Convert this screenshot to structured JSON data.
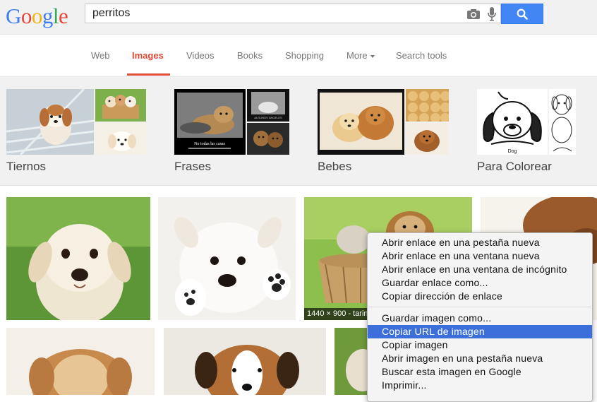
{
  "logo": {
    "letters": [
      "G",
      "o",
      "o",
      "g",
      "l",
      "e"
    ],
    "colors": [
      "#3f7ef0",
      "#e8443a",
      "#f2b50f",
      "#3f7ef0",
      "#31a852",
      "#e8443a"
    ]
  },
  "search": {
    "query": "perritos",
    "placeholder": ""
  },
  "icons": {
    "camera": "camera-icon",
    "mic": "mic-icon",
    "search": "magnifier-icon"
  },
  "tabs": [
    {
      "label": "Web"
    },
    {
      "label": "Images",
      "active": true
    },
    {
      "label": "Videos"
    },
    {
      "label": "Books"
    },
    {
      "label": "Shopping"
    },
    {
      "label": "More"
    },
    {
      "label": "Search tools"
    }
  ],
  "related": [
    {
      "label": "Tiernos"
    },
    {
      "label": "Frases"
    },
    {
      "label": "Bebes"
    },
    {
      "label": "Para Colorear"
    }
  ],
  "thumb_text": {
    "frases_main": "No todas las casas",
    "frases_small": "ALGUNOS ÁNGELES",
    "bebes_caption": "Dog"
  },
  "image_overlay": "1440 × 900 - tarin",
  "context_menu": {
    "items": [
      "Abrir enlace en una pestaña nueva",
      "Abrir enlace en una ventana nueva",
      "Abrir enlace en una ventana de incógnito",
      "Guardar enlace como...",
      "Copiar dirección de enlace",
      "Guardar imagen como...",
      "Copiar URL de imagen",
      "Copiar imagen",
      "Abrir imagen en una pestaña nueva",
      "Buscar esta imagen en Google",
      "Imprimir..."
    ],
    "highlighted": "Copiar URL de imagen"
  },
  "colors": {
    "accent": "#dd4b39",
    "search_blue": "#4285f4",
    "menu_highlight": "#3d6fdb"
  }
}
